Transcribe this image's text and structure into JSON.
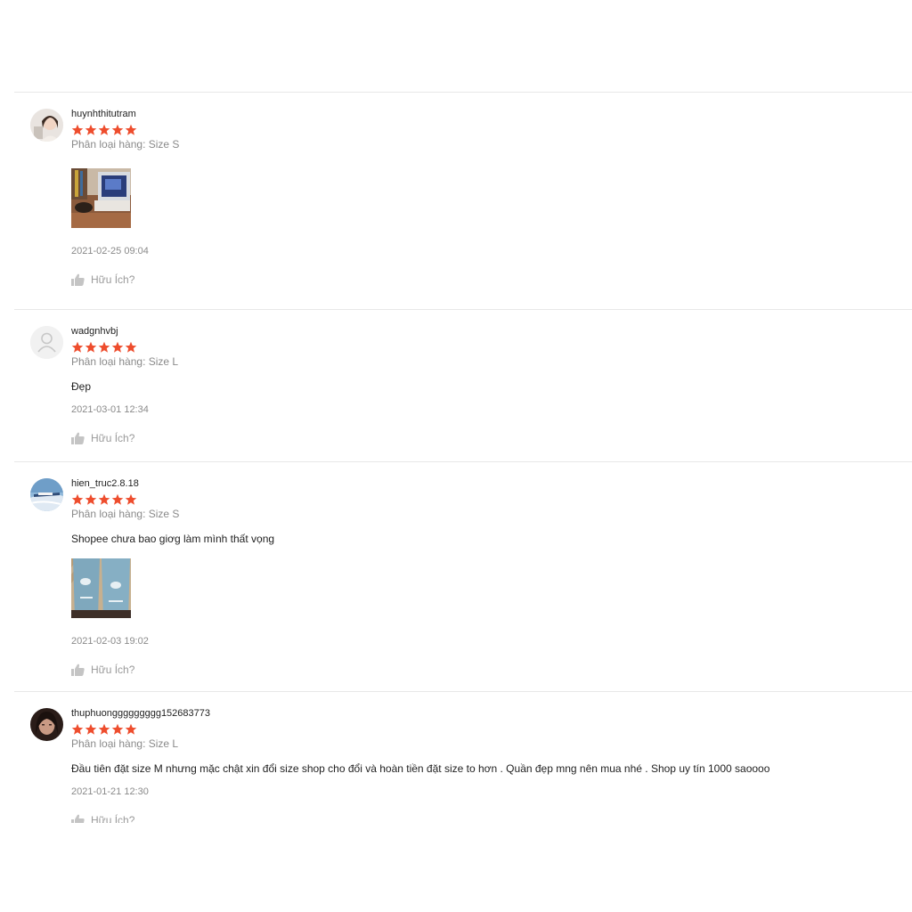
{
  "reviews": [
    {
      "username": "huynhthitutram",
      "variant": "Phân loại hàng: Size S",
      "comment": "",
      "time": "2021-02-25 09:04",
      "helpful": "Hữu Ích?",
      "rating": 5
    },
    {
      "username": "wadgnhvbj",
      "variant": "Phân loại hàng: Size L",
      "comment": "Đẹp",
      "time": "2021-03-01 12:34",
      "helpful": "Hữu Ích?",
      "rating": 5
    },
    {
      "username": "hien_truc2.8.18",
      "variant": "Phân loại hàng: Size S",
      "comment": "Shopee chưa bao giơg làm mình thất vọng",
      "time": "2021-02-03 19:02",
      "helpful": "Hữu Ích?",
      "rating": 5
    },
    {
      "username": "thuphuonggggggggg152683773",
      "variant": "Phân loại hàng: Size L",
      "comment": "Đầu tiên đặt size M nhưng mặc chật xin đổi size shop cho đổi và hoàn tiền đặt size to hơn . Quần đẹp mng nên mua nhé . Shop uy tín 1000 saoooo",
      "time": "2021-01-21 12:30",
      "helpful": "Hữu Ích?",
      "rating": 5
    }
  ],
  "colors": {
    "star": "#ee4d2d",
    "muted": "#8a8a8a",
    "divider": "#e8e8e8"
  },
  "icons": {
    "star": "star-icon",
    "like": "thumbs-up-icon",
    "default_avatar": "user-icon"
  }
}
